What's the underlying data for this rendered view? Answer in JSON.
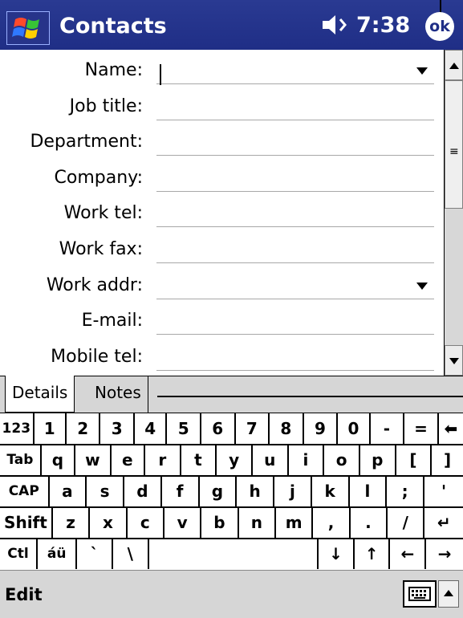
{
  "titlebar": {
    "app_title": "Contacts",
    "time": "7:38",
    "ok_label": "ok",
    "background": "#1f2e86"
  },
  "form": {
    "fields": [
      {
        "label": "Name:",
        "has_dropdown": true
      },
      {
        "label": "Job title:",
        "has_dropdown": false
      },
      {
        "label": "Department:",
        "has_dropdown": false
      },
      {
        "label": "Company:",
        "has_dropdown": false
      },
      {
        "label": "Work tel:",
        "has_dropdown": false
      },
      {
        "label": "Work fax:",
        "has_dropdown": false
      },
      {
        "label": "Work addr:",
        "has_dropdown": true
      },
      {
        "label": "E-mail:",
        "has_dropdown": false
      },
      {
        "label": "Mobile tel:",
        "has_dropdown": false
      }
    ]
  },
  "tabs": {
    "details": "Details",
    "notes": "Notes"
  },
  "keyboard": {
    "rows": [
      [
        "123",
        "1",
        "2",
        "3",
        "4",
        "5",
        "6",
        "7",
        "8",
        "9",
        "0",
        "-",
        "=",
        "⬅"
      ],
      [
        "Tab",
        "q",
        "w",
        "e",
        "r",
        "t",
        "y",
        "u",
        "i",
        "o",
        "p",
        "[",
        "]"
      ],
      [
        "CAP",
        "a",
        "s",
        "d",
        "f",
        "g",
        "h",
        "j",
        "k",
        "l",
        ";",
        "'"
      ],
      [
        "Shift",
        "z",
        "x",
        "c",
        "v",
        "b",
        "n",
        "m",
        ",",
        ".",
        "/",
        "↵"
      ],
      [
        "Ctl",
        "áü",
        "`",
        "\\",
        "",
        "↓",
        "↑",
        "←",
        "→"
      ]
    ]
  },
  "menubar": {
    "edit_label": "Edit"
  }
}
